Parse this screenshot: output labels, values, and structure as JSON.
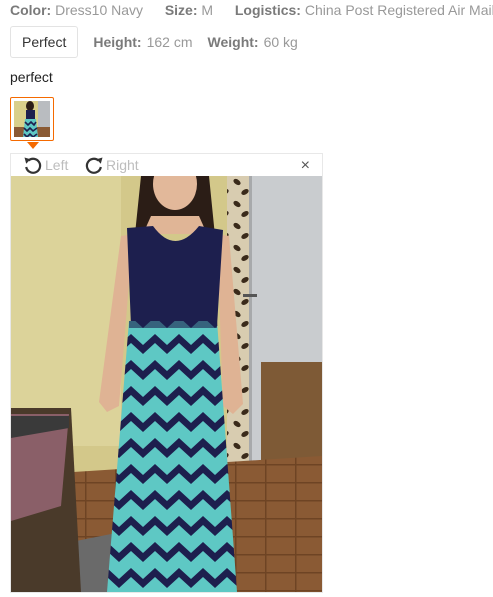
{
  "attributes": {
    "color_label": "Color:",
    "color_value": "Dress10 Navy",
    "size_label": "Size:",
    "size_value": "M",
    "logistics_label": "Logistics:",
    "logistics_value": "China Post Registered Air Mail"
  },
  "buyer": {
    "tag": "Perfect",
    "height_label": "Height:",
    "height_value": "162 cm",
    "weight_label": "Weight:",
    "weight_value": "60 kg"
  },
  "feedback": {
    "text": "perfect"
  },
  "viewer": {
    "rotate_left_label": "Left",
    "rotate_right_label": "Right",
    "close_glyph": "×"
  },
  "colors": {
    "accent": "#f56a00",
    "navy": "#1d1f4e",
    "mint": "#5ec8c4"
  },
  "icons": {
    "rotate_left": "rotate-left-icon",
    "rotate_right": "rotate-right-icon",
    "close": "close-icon"
  }
}
